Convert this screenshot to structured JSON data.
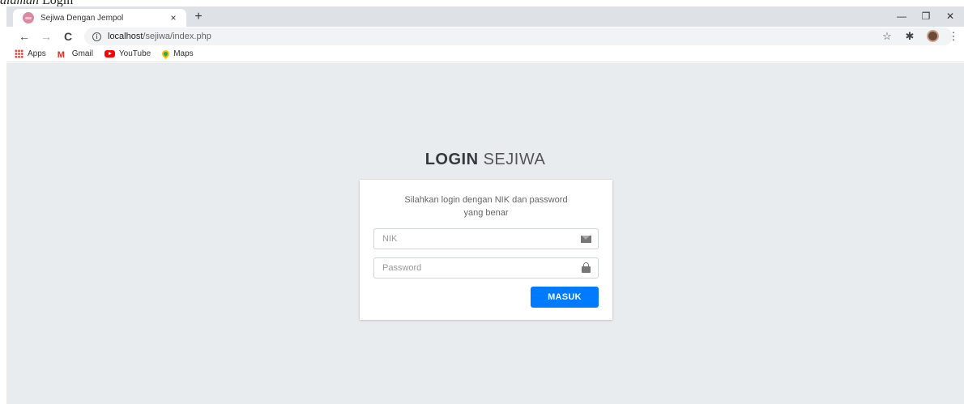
{
  "caption": {
    "italic": "alaman",
    "roman": "Login"
  },
  "browser": {
    "tab_title": "Sejiwa Dengan Jempol",
    "tab_close": "×",
    "new_tab": "+",
    "window": {
      "minimize": "—",
      "restore": "❐",
      "close": "✕"
    },
    "nav": {
      "back": "←",
      "forward": "→",
      "reload": "C"
    },
    "url_host": "localhost",
    "url_path": "/sejiwa/index.php",
    "bookmarks": [
      {
        "label": "Apps",
        "icon": "apps-icon"
      },
      {
        "label": "Gmail",
        "icon": "gmail-icon"
      },
      {
        "label": "YouTube",
        "icon": "youtube-icon"
      },
      {
        "label": "Maps",
        "icon": "maps-icon"
      }
    ]
  },
  "login": {
    "title_bold": "LOGIN",
    "title_light": "SEJIWA",
    "message": "Silahkan login dengan NIK dan password yang benar",
    "nik_placeholder": "NIK",
    "password_placeholder": "Password",
    "submit_label": "MASUK"
  },
  "colors": {
    "viewport_bg": "#e9ecef",
    "button": "#007bff"
  }
}
